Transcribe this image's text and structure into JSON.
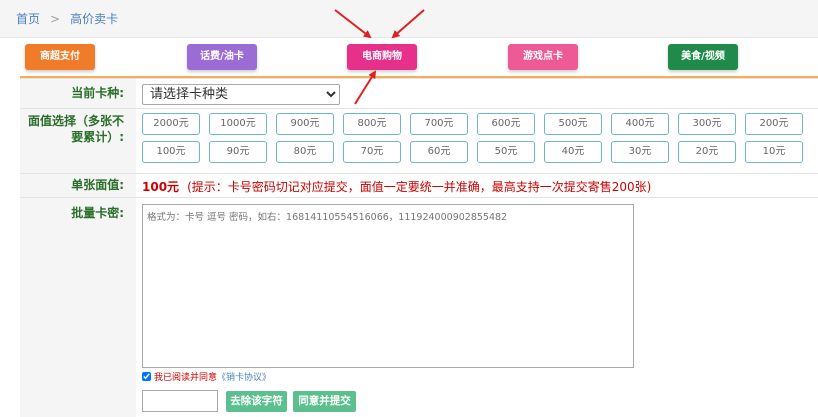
{
  "breadcrumb": {
    "home": "首页",
    "separator": ">",
    "current": "高价卖卡"
  },
  "categories": [
    {
      "label": "商超支付",
      "color": "#f07c2a"
    },
    {
      "label": "话费/油卡",
      "color": "#9b6cd6"
    },
    {
      "label": "电商购物",
      "color": "#e6308a"
    },
    {
      "label": "游戏点卡",
      "color": "#ee5a96"
    },
    {
      "label": "美食/视频",
      "color": "#1f8a4a"
    }
  ],
  "form": {
    "card_type_label": "当前卡种:",
    "card_type_selected": "请选择卡种类",
    "denomination_label": "面值选择（多张不要累计）:",
    "denominations_row1": [
      "2000元",
      "1000元",
      "900元",
      "800元",
      "700元",
      "600元",
      "500元",
      "400元",
      "300元",
      "200元"
    ],
    "denominations_row2": [
      "100元",
      "90元",
      "80元",
      "70元",
      "60元",
      "50元",
      "40元",
      "30元",
      "20元",
      "10元"
    ],
    "unit_price_label": "单张面值:",
    "unit_price_value": "100元",
    "unit_price_hint": "(提示：卡号密码切记对应提交，面值一定要统一并准确，最高支持一次提交寄售200张)",
    "batch_label": "批量卡密:",
    "batch_placeholder": "格式为：卡号 逗号 密码，如右：16814110554516066，111924000902855482",
    "agree_text": "我已阅读并同意",
    "agree_link": "《销卡协议》",
    "agree_checked": true,
    "remove_chars_button": "去除该字符",
    "submit_button": "同意并提交"
  },
  "colors": {
    "accent_border": "#f6ad55",
    "label_green": "#2a6e2a",
    "button_green": "#5bc08e",
    "amount_border": "#6eb5d4",
    "arrow_red": "#e02020"
  }
}
